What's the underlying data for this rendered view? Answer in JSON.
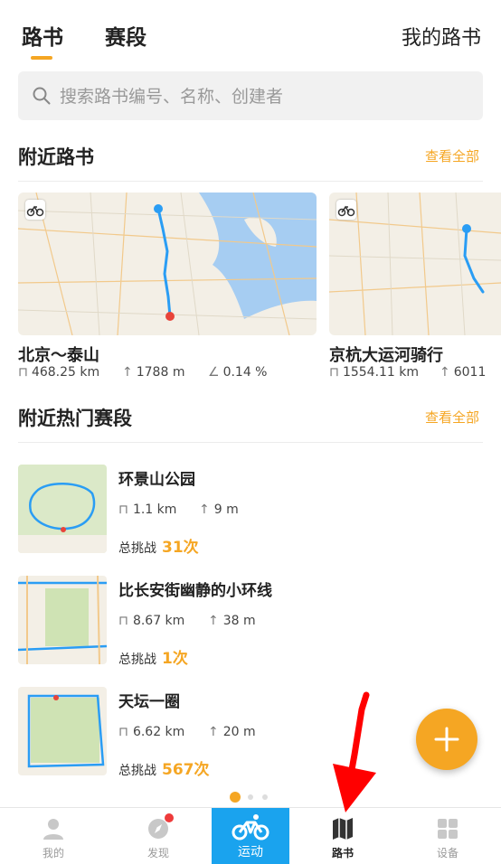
{
  "header": {
    "tabs": [
      {
        "label": "路书",
        "active": true
      },
      {
        "label": "赛段",
        "active": false
      }
    ],
    "my_routes_label": "我的路书",
    "accent_color": "#f5a623"
  },
  "search": {
    "placeholder": "搜索路书编号、名称、创建者"
  },
  "nearby_routes": {
    "title": "附近路书",
    "view_all": "查看全部",
    "cards": [
      {
        "name": "北京～泰山",
        "distance": "468.25 km",
        "elevation": "1788 m",
        "grade": "0.14 %",
        "type_icon": "bicycle-icon"
      },
      {
        "name": "京杭大运河骑行",
        "distance": "1554.11 km",
        "elevation": "6011",
        "type_icon": "bicycle-icon"
      }
    ]
  },
  "nearby_segments": {
    "title": "附近热门赛段",
    "view_all": "查看全部",
    "challenge_label": "总挑战",
    "items": [
      {
        "name": "环景山公园",
        "distance": "1.1 km",
        "elevation": "9 m",
        "challenges": "31次"
      },
      {
        "name": "比长安街幽静的小环线",
        "distance": "8.67 km",
        "elevation": "38 m",
        "challenges": "1次"
      },
      {
        "name": "天坛一圈",
        "distance": "6.62 km",
        "elevation": "20 m",
        "challenges": "567次"
      }
    ]
  },
  "fab": {
    "icon": "plus-icon"
  },
  "pager": {
    "count": 3,
    "active_index": 0
  },
  "bottom_nav": [
    {
      "label": "我的",
      "icon": "person-icon",
      "active": false
    },
    {
      "label": "发现",
      "icon": "compass-icon",
      "active": false,
      "badge": true
    },
    {
      "label": "运动",
      "icon": "bicycle-icon",
      "active": true
    },
    {
      "label": "路书",
      "icon": "map-icon",
      "active": false,
      "bold": true
    },
    {
      "label": "设备",
      "icon": "grid-icon",
      "active": false
    }
  ],
  "annotation": {
    "icon": "red-arrow-icon",
    "color": "#ff0000"
  }
}
